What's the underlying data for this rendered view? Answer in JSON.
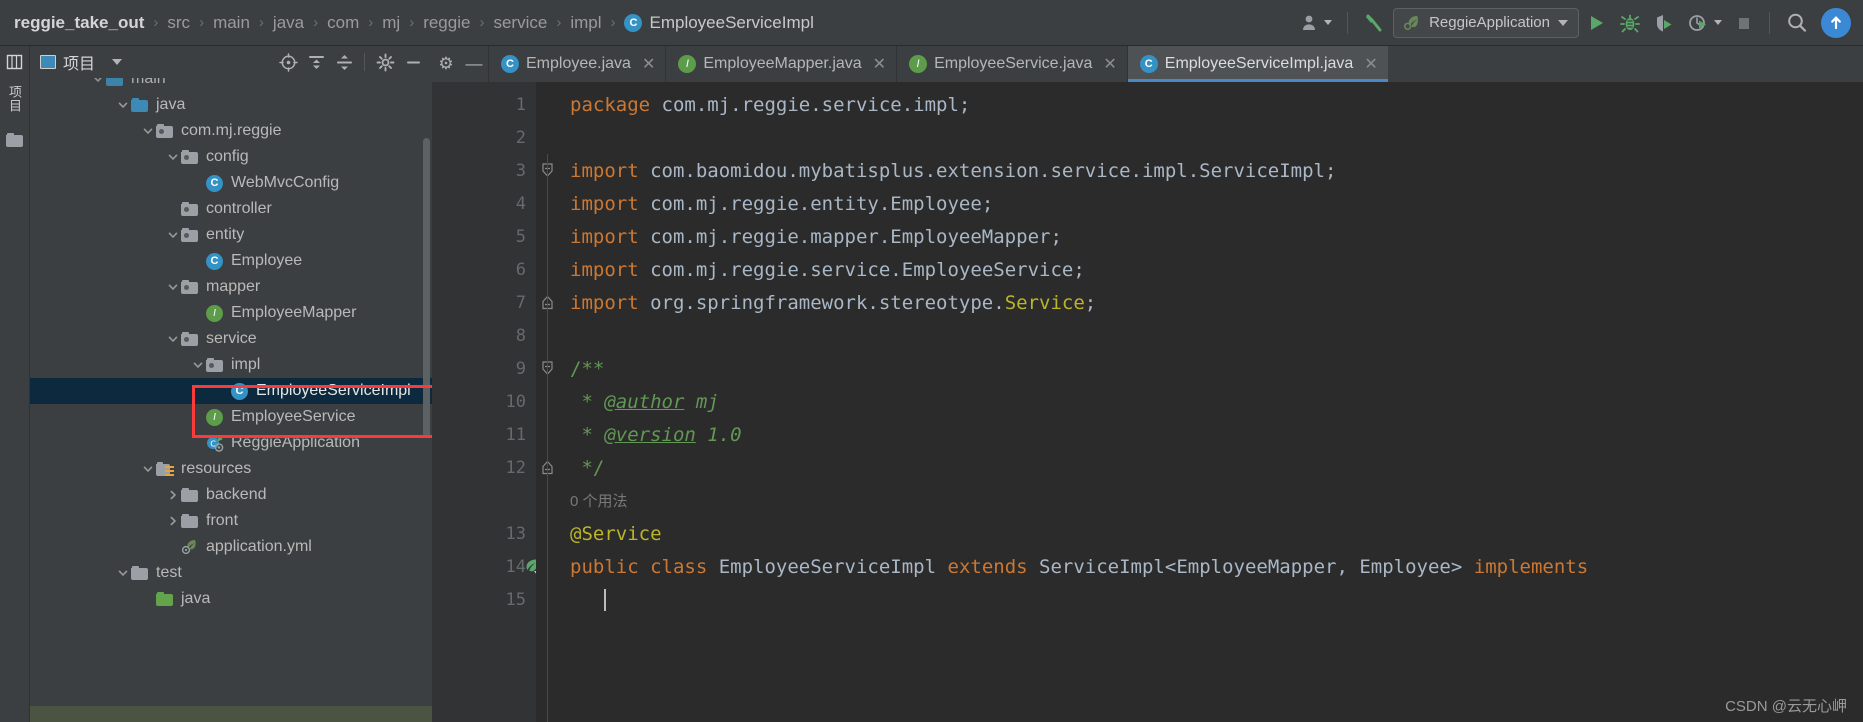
{
  "toolbar": {
    "breadcrumb": [
      {
        "label": "reggie_take_out",
        "type": "root"
      },
      {
        "label": "src",
        "type": "dir"
      },
      {
        "label": "main",
        "type": "dir"
      },
      {
        "label": "java",
        "type": "dir"
      },
      {
        "label": "com",
        "type": "dir"
      },
      {
        "label": "mj",
        "type": "dir"
      },
      {
        "label": "reggie",
        "type": "dir"
      },
      {
        "label": "service",
        "type": "dir"
      },
      {
        "label": "impl",
        "type": "dir"
      },
      {
        "label": "EmployeeServiceImpl",
        "type": "class",
        "badge": "C"
      }
    ],
    "separator": "›",
    "run_config": {
      "label": "ReggieApplication",
      "icon": "spring-leaf-icon"
    },
    "icons": {
      "account": "account-icon",
      "build": "build-hammer-icon",
      "run": "run-icon",
      "debug": "debug-bug-icon",
      "run_coverage": "run-with-coverage-icon",
      "profiler": "profiler-icon",
      "stop": "stop-icon",
      "search": "search-everywhere-icon",
      "updates": "updates-arrow-icon"
    },
    "accent_blue": "#3b89d4",
    "accent_green": "#59a869"
  },
  "rail": {
    "project_label": "项目",
    "items": [
      {
        "name": "project-tool-window",
        "label": "项目"
      },
      {
        "name": "structure-tool-window",
        "label": ""
      }
    ]
  },
  "project_panel": {
    "title": "项目",
    "header_icons": [
      {
        "name": "select-opened-file-icon"
      },
      {
        "name": "expand-all-icon"
      },
      {
        "name": "collapse-all-icon"
      },
      {
        "name": "settings-gear-icon"
      },
      {
        "name": "hide-panel-icon"
      }
    ],
    "tree": [
      {
        "label": "main",
        "indent": 2,
        "arrow": "down",
        "icon": "folder-src",
        "selected": false,
        "partial": true
      },
      {
        "label": "java",
        "indent": 3,
        "arrow": "down",
        "icon": "folder-src",
        "selected": false
      },
      {
        "label": "com.mj.reggie",
        "indent": 4,
        "arrow": "down",
        "icon": "folder-pkg",
        "selected": false
      },
      {
        "label": "config",
        "indent": 5,
        "arrow": "down",
        "icon": "folder-pkg",
        "selected": false
      },
      {
        "label": "WebMvcConfig",
        "indent": 6,
        "arrow": "none",
        "icon": "class",
        "selected": false
      },
      {
        "label": "controller",
        "indent": 5,
        "arrow": "none",
        "icon": "folder-pkg",
        "selected": false
      },
      {
        "label": "entity",
        "indent": 5,
        "arrow": "down",
        "icon": "folder-pkg",
        "selected": false
      },
      {
        "label": "Employee",
        "indent": 6,
        "arrow": "none",
        "icon": "class",
        "selected": false
      },
      {
        "label": "mapper",
        "indent": 5,
        "arrow": "down",
        "icon": "folder-pkg",
        "selected": false
      },
      {
        "label": "EmployeeMapper",
        "indent": 6,
        "arrow": "none",
        "icon": "interface",
        "selected": false
      },
      {
        "label": "service",
        "indent": 5,
        "arrow": "down",
        "icon": "folder-pkg",
        "selected": false
      },
      {
        "label": "impl",
        "indent": 6,
        "arrow": "down",
        "icon": "folder-pkg",
        "selected": false
      },
      {
        "label": "EmployeeServiceImpl",
        "indent": 7,
        "arrow": "none",
        "icon": "class",
        "selected": true
      },
      {
        "label": "EmployeeService",
        "indent": 6,
        "arrow": "none",
        "icon": "interface",
        "selected": false
      },
      {
        "label": "ReggieApplication",
        "indent": 6,
        "arrow": "none",
        "icon": "spring-class",
        "selected": false
      },
      {
        "label": "resources",
        "indent": 4,
        "arrow": "down",
        "icon": "folder-resources",
        "selected": false
      },
      {
        "label": "backend",
        "indent": 5,
        "arrow": "right",
        "icon": "folder-plain",
        "selected": false
      },
      {
        "label": "front",
        "indent": 5,
        "arrow": "right",
        "icon": "folder-plain",
        "selected": false
      },
      {
        "label": "application.yml",
        "indent": 5,
        "arrow": "none",
        "icon": "yml",
        "selected": false
      },
      {
        "label": "test",
        "indent": 3,
        "arrow": "down",
        "icon": "folder-plain",
        "selected": false
      },
      {
        "label": "java",
        "indent": 4,
        "arrow": "none",
        "icon": "folder-green",
        "selected": false
      }
    ],
    "annotation_color": "#fb3b3b",
    "selection_color": "#0d293e"
  },
  "editor": {
    "tabs": [
      {
        "label": "Employee.java",
        "icon": "class",
        "active": false
      },
      {
        "label": "EmployeeMapper.java",
        "icon": "interface",
        "active": false
      },
      {
        "label": "EmployeeService.java",
        "icon": "interface",
        "active": false
      },
      {
        "label": "EmployeeServiceImpl.java",
        "icon": "class",
        "active": true
      }
    ],
    "close_glyph": "✕",
    "tab_controls": [
      {
        "name": "editor-settings-gear-icon",
        "glyph": "⚙"
      },
      {
        "name": "hide-editor-icon",
        "glyph": "—"
      }
    ],
    "active_tab_underline": "#4a88c7",
    "lines": [
      {
        "num": "1",
        "fold": "none",
        "tokens": [
          {
            "t": "package ",
            "c": "kw"
          },
          {
            "t": "com.mj.reggie.service.impl;",
            "c": "id"
          }
        ]
      },
      {
        "num": "2",
        "fold": "none",
        "tokens": []
      },
      {
        "num": "3",
        "fold": "start",
        "tokens": [
          {
            "t": "import ",
            "c": "kw"
          },
          {
            "t": "com.baomidou.mybatisplus.extension.service.impl.",
            "c": "id"
          },
          {
            "t": "ServiceImpl",
            "c": "cls"
          },
          {
            "t": ";",
            "c": "id"
          }
        ]
      },
      {
        "num": "4",
        "fold": "body",
        "tokens": [
          {
            "t": "import ",
            "c": "kw"
          },
          {
            "t": "com.mj.reggie.entity.",
            "c": "id"
          },
          {
            "t": "Employee",
            "c": "cls"
          },
          {
            "t": ";",
            "c": "id"
          }
        ]
      },
      {
        "num": "5",
        "fold": "body",
        "tokens": [
          {
            "t": "import ",
            "c": "kw"
          },
          {
            "t": "com.mj.reggie.mapper.",
            "c": "id"
          },
          {
            "t": "EmployeeMapper",
            "c": "cls"
          },
          {
            "t": ";",
            "c": "id"
          }
        ]
      },
      {
        "num": "6",
        "fold": "body",
        "tokens": [
          {
            "t": "import ",
            "c": "kw"
          },
          {
            "t": "com.mj.reggie.service.",
            "c": "id"
          },
          {
            "t": "EmployeeService",
            "c": "cls"
          },
          {
            "t": ";",
            "c": "id"
          }
        ]
      },
      {
        "num": "7",
        "fold": "end",
        "tokens": [
          {
            "t": "import ",
            "c": "kw"
          },
          {
            "t": "org.springframework.stereotype.",
            "c": "id"
          },
          {
            "t": "Service",
            "c": "ann"
          },
          {
            "t": ";",
            "c": "id"
          }
        ]
      },
      {
        "num": "8",
        "fold": "none",
        "tokens": []
      },
      {
        "num": "9",
        "fold": "start",
        "tokens": [
          {
            "t": "/**",
            "c": "cmt"
          }
        ]
      },
      {
        "num": "10",
        "fold": "body",
        "tokens": [
          {
            "t": " * ",
            "c": "cmt"
          },
          {
            "t": "@author",
            "c": "cmt-tag"
          },
          {
            "t": " mj",
            "c": "cmt-val"
          }
        ]
      },
      {
        "num": "11",
        "fold": "body",
        "tokens": [
          {
            "t": " * ",
            "c": "cmt"
          },
          {
            "t": "@version",
            "c": "cmt-tag"
          },
          {
            "t": " 1.0",
            "c": "cmt-val"
          }
        ]
      },
      {
        "num": "12",
        "fold": "end",
        "tokens": [
          {
            "t": " */",
            "c": "cmt"
          }
        ]
      },
      {
        "num": "",
        "fold": "none",
        "hint": "0 个用法",
        "tokens": []
      },
      {
        "num": "13",
        "fold": "none",
        "tokens": [
          {
            "t": "@Service",
            "c": "ann"
          }
        ]
      },
      {
        "num": "14",
        "fold": "none",
        "bean": true,
        "tokens": [
          {
            "t": "public ",
            "c": "kw"
          },
          {
            "t": "class ",
            "c": "kw"
          },
          {
            "t": "EmployeeServiceImpl ",
            "c": "cls"
          },
          {
            "t": "extends ",
            "c": "kw"
          },
          {
            "t": "ServiceImpl",
            "c": "cls"
          },
          {
            "t": "<",
            "c": "id"
          },
          {
            "t": "EmployeeMapper",
            "c": "cls"
          },
          {
            "t": ", ",
            "c": "id"
          },
          {
            "t": "Employee",
            "c": "cls"
          },
          {
            "t": "> ",
            "c": "id"
          },
          {
            "t": "implements",
            "c": "kw"
          }
        ]
      },
      {
        "num": "15",
        "fold": "none",
        "caret": true,
        "tokens": []
      }
    ],
    "usage_hint": "0 个用法",
    "watermark": "CSDN @云无心岬",
    "colors": {
      "background": "#2b2b2b",
      "gutter": "#313335",
      "keyword": "#cc7832",
      "identifier": "#a9b7c6",
      "annotation": "#bbb529",
      "comment": "#629755",
      "line_number": "#666a6d"
    }
  }
}
